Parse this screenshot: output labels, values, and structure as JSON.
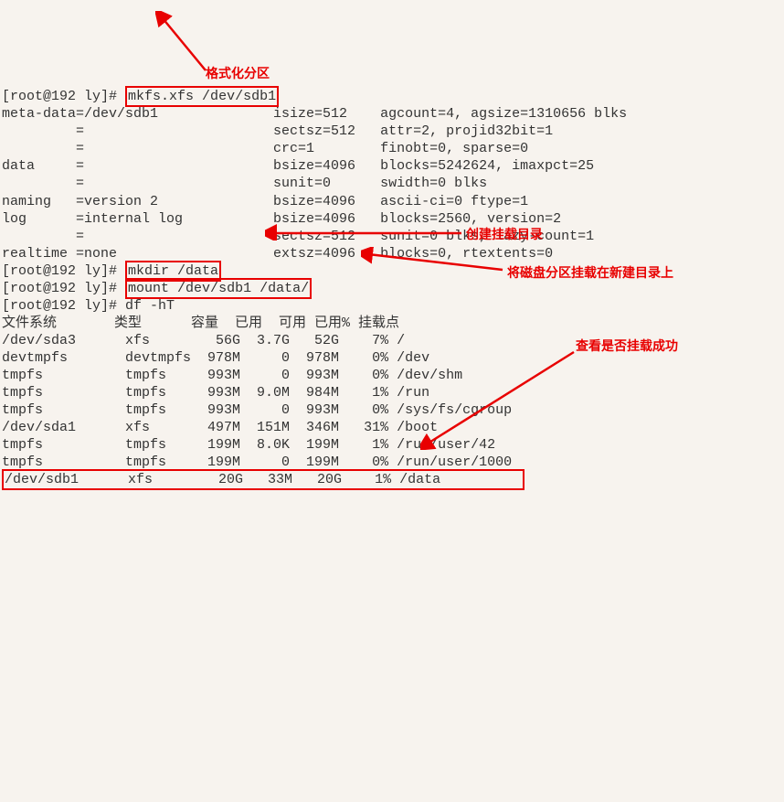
{
  "prompt": "[root@192 ly]#",
  "cmd1": "mkfs.xfs /dev/sdb1",
  "mkfs_out": [
    "meta-data=/dev/sdb1              isize=512    agcount=4, agsize=1310656 blks",
    "         =                       sectsz=512   attr=2, projid32bit=1",
    "         =                       crc=1        finobt=0, sparse=0",
    "data     =                       bsize=4096   blocks=5242624, imaxpct=25",
    "         =                       sunit=0      swidth=0 blks",
    "naming   =version 2              bsize=4096   ascii-ci=0 ftype=1",
    "log      =internal log           bsize=4096   blocks=2560, version=2",
    "         =                       sectsz=512   sunit=0 blks, lazy-count=1",
    "realtime =none                   extsz=4096   blocks=0, rtextents=0"
  ],
  "cmd2": "mkdir /data",
  "cmd3": "mount /dev/sdb1 /data/",
  "cmd4": "df -hT",
  "df_header": "文件系统       类型      容量  已用  可用 已用% 挂载点",
  "df_rows": [
    "/dev/sda3      xfs        56G  3.7G   52G    7% /",
    "devtmpfs       devtmpfs  978M     0  978M    0% /dev",
    "tmpfs          tmpfs     993M     0  993M    0% /dev/shm",
    "tmpfs          tmpfs     993M  9.0M  984M    1% /run",
    "tmpfs          tmpfs     993M     0  993M    0% /sys/fs/cgroup",
    "/dev/sda1      xfs       497M  151M  346M   31% /boot",
    "tmpfs          tmpfs     199M  8.0K  199M    1% /run/user/42",
    "tmpfs          tmpfs     199M     0  199M    0% /run/user/1000"
  ],
  "df_last": "/dev/sdb1      xfs        20G   33M   20G    1% /data",
  "anno1": "格式化分区",
  "anno2": "创建挂载目录",
  "anno3": "将磁盘分区挂载在新建目录上",
  "anno4": "查看是否挂载成功"
}
